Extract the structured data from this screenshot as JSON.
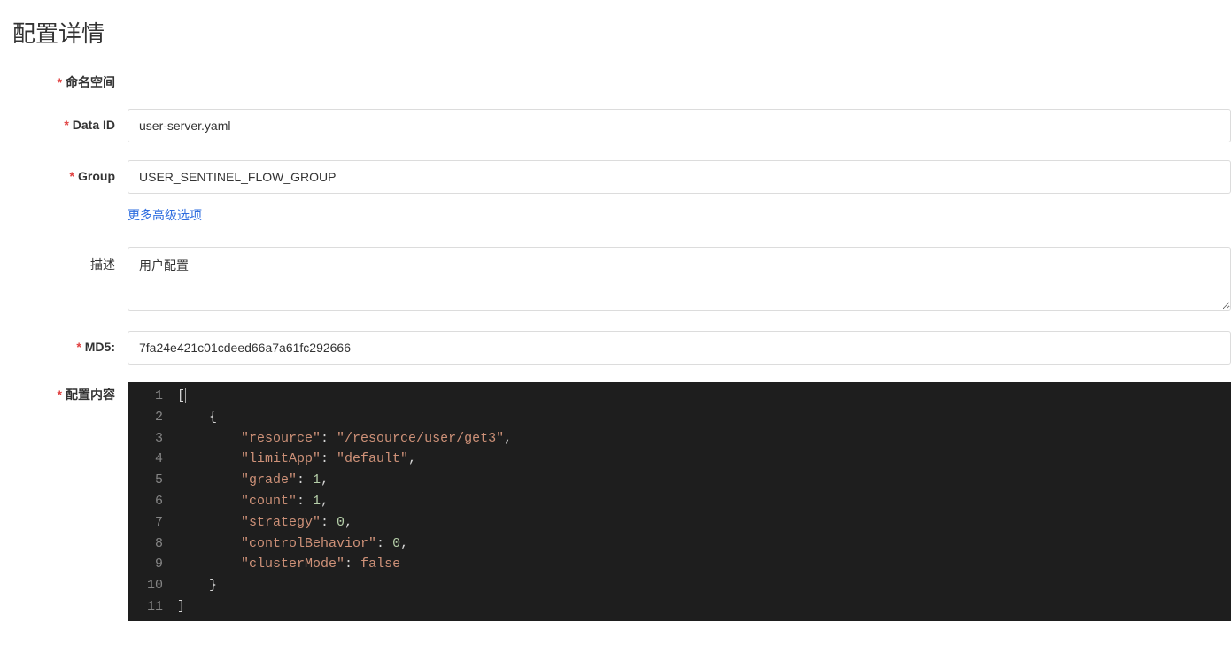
{
  "title": "配置详情",
  "labels": {
    "namespace": "命名空间",
    "data_id": "Data ID",
    "group": "Group",
    "more": "更多高级选项",
    "description": "描述",
    "md5": "MD5:",
    "content": "配置内容"
  },
  "values": {
    "data_id": "user-server.yaml",
    "group": "USER_SENTINEL_FLOW_GROUP",
    "description": "用户配置",
    "md5": "7fa24e421c01cdeed66a7a61fc292666"
  },
  "code_tokens": [
    [
      [
        "brkt",
        "["
      ]
    ],
    [
      [
        "punct",
        "    {"
      ]
    ],
    [
      [
        "punct",
        "        "
      ],
      [
        "key",
        "\"resource\""
      ],
      [
        "punct",
        ": "
      ],
      [
        "str",
        "\"/resource/user/get3\""
      ],
      [
        "punct",
        ","
      ]
    ],
    [
      [
        "punct",
        "        "
      ],
      [
        "key",
        "\"limitApp\""
      ],
      [
        "punct",
        ": "
      ],
      [
        "str",
        "\"default\""
      ],
      [
        "punct",
        ","
      ]
    ],
    [
      [
        "punct",
        "        "
      ],
      [
        "key",
        "\"grade\""
      ],
      [
        "punct",
        ": "
      ],
      [
        "num",
        "1"
      ],
      [
        "punct",
        ","
      ]
    ],
    [
      [
        "punct",
        "        "
      ],
      [
        "key",
        "\"count\""
      ],
      [
        "punct",
        ": "
      ],
      [
        "num",
        "1"
      ],
      [
        "punct",
        ","
      ]
    ],
    [
      [
        "punct",
        "        "
      ],
      [
        "key",
        "\"strategy\""
      ],
      [
        "punct",
        ": "
      ],
      [
        "num",
        "0"
      ],
      [
        "punct",
        ","
      ]
    ],
    [
      [
        "punct",
        "        "
      ],
      [
        "key",
        "\"controlBehavior\""
      ],
      [
        "punct",
        ": "
      ],
      [
        "num",
        "0"
      ],
      [
        "punct",
        ","
      ]
    ],
    [
      [
        "punct",
        "        "
      ],
      [
        "key",
        "\"clusterMode\""
      ],
      [
        "punct",
        ": "
      ],
      [
        "bool",
        "false"
      ]
    ],
    [
      [
        "punct",
        "    }"
      ]
    ],
    [
      [
        "brkt",
        "]"
      ]
    ]
  ]
}
